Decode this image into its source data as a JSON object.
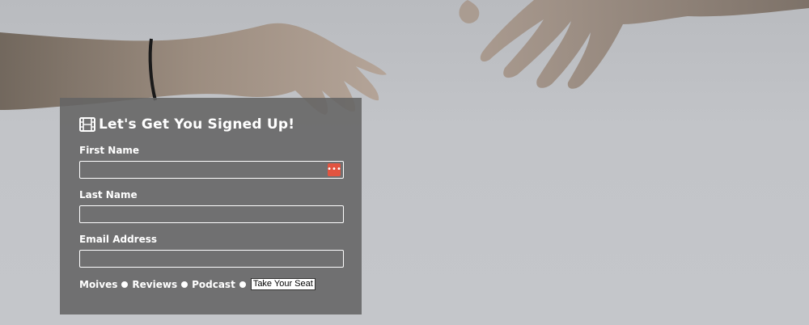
{
  "form": {
    "title": "Let's Get You Signed Up!",
    "title_icon": "film-icon",
    "fields": [
      {
        "label": "First Name",
        "value": "",
        "placeholder": ""
      },
      {
        "label": "Last Name",
        "value": "",
        "placeholder": ""
      },
      {
        "label": "Email Address",
        "value": "",
        "placeholder": ""
      }
    ],
    "autofill_icon": "password-manager-icon",
    "autofill_glyph": "•••",
    "nav_links": [
      "Moives",
      "Reviews",
      "Podcast"
    ],
    "submit_label": "Take Your Seat"
  },
  "colors": {
    "card_bg": "#646464",
    "text": "#ffffff",
    "autofill": "#e25440"
  }
}
